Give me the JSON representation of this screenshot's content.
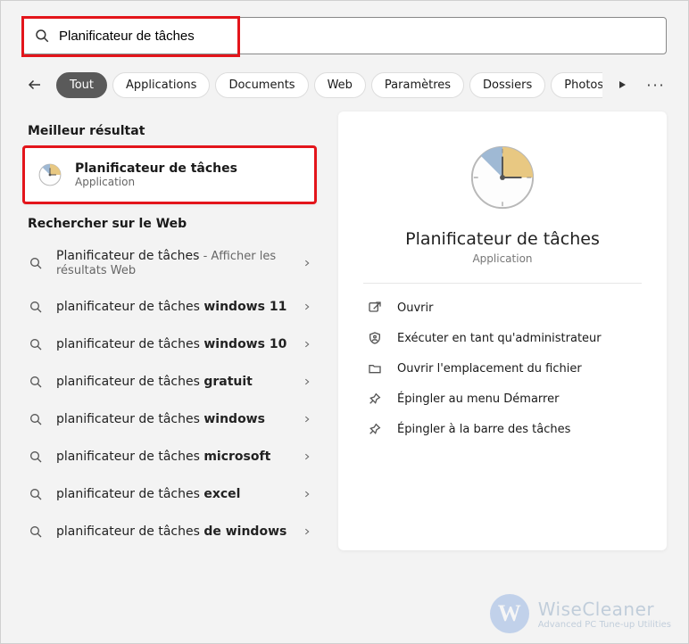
{
  "search": {
    "value": "Planificateur de tâches"
  },
  "filters": {
    "items": [
      "Tout",
      "Applications",
      "Documents",
      "Web",
      "Paramètres",
      "Dossiers",
      "Photos"
    ],
    "active_index": 0
  },
  "sections": {
    "best": "Meilleur résultat",
    "web": "Rechercher sur le Web"
  },
  "best_result": {
    "title": "Planificateur de tâches",
    "subtitle": "Application"
  },
  "web_results": [
    {
      "prefix": "Planificateur de tâches",
      "suffix_bold": "",
      "sub": " - Afficher les résultats Web"
    },
    {
      "prefix": "planificateur de tâches ",
      "suffix_bold": "windows 11",
      "sub": ""
    },
    {
      "prefix": "planificateur de tâches ",
      "suffix_bold": "windows 10",
      "sub": ""
    },
    {
      "prefix": "planificateur de tâches ",
      "suffix_bold": "gratuit",
      "sub": ""
    },
    {
      "prefix": "planificateur de tâches ",
      "suffix_bold": "windows",
      "sub": ""
    },
    {
      "prefix": "planificateur de tâches ",
      "suffix_bold": "microsoft",
      "sub": ""
    },
    {
      "prefix": "planificateur de tâches ",
      "suffix_bold": "excel",
      "sub": ""
    },
    {
      "prefix": "planificateur de tâches ",
      "suffix_bold": "de windows",
      "sub": ""
    }
  ],
  "preview": {
    "title": "Planificateur de tâches",
    "subtitle": "Application",
    "actions": [
      {
        "icon": "open",
        "label": "Ouvrir"
      },
      {
        "icon": "admin",
        "label": "Exécuter en tant qu'administrateur"
      },
      {
        "icon": "folder",
        "label": "Ouvrir l'emplacement du fichier"
      },
      {
        "icon": "pin",
        "label": "Épingler au menu Démarrer"
      },
      {
        "icon": "pin",
        "label": "Épingler à la barre des tâches"
      }
    ]
  },
  "watermark": {
    "brand": "WiseCleaner",
    "tagline": "Advanced PC Tune-up Utilities",
    "glyph": "W"
  }
}
